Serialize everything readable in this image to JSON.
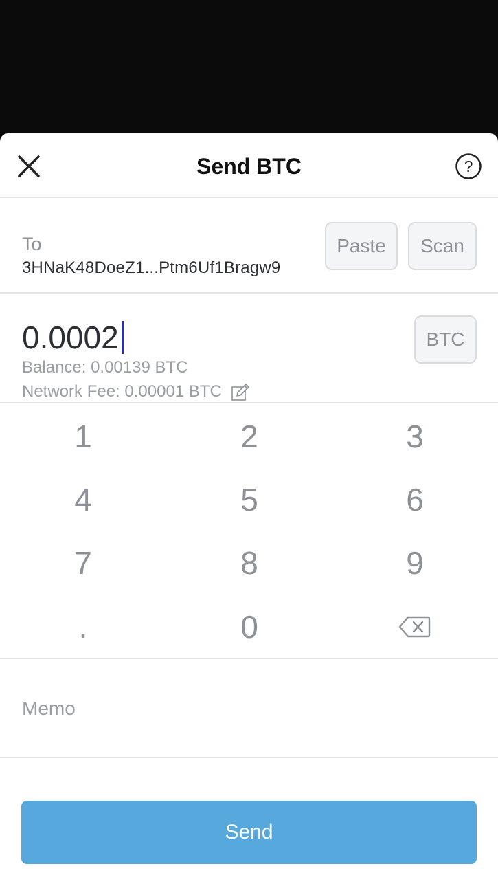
{
  "header": {
    "title": "Send BTC",
    "close_icon": "close-icon",
    "help_icon": "help-circle-icon"
  },
  "recipient": {
    "label": "To",
    "address": "3HNaK48DoeZ1...Ptm6Uf1Bragw9",
    "paste_label": "Paste",
    "scan_label": "Scan"
  },
  "amount": {
    "value": "0.0002",
    "currency_label": "BTC",
    "balance": "Balance: 0.00139 BTC",
    "network_fee": "Network Fee: 0.00001 BTC",
    "edit_icon": "edit-pencil-icon"
  },
  "keypad": {
    "keys": [
      "1",
      "2",
      "3",
      "4",
      "5",
      "6",
      "7",
      "8",
      "9",
      ".",
      "0"
    ],
    "backspace_icon": "backspace-icon"
  },
  "memo": {
    "placeholder": "Memo",
    "value": ""
  },
  "send": {
    "label": "Send"
  },
  "colors": {
    "accent": "#56a8dd",
    "caret": "#1f2bd8",
    "backdrop": "#0b0b0c"
  }
}
